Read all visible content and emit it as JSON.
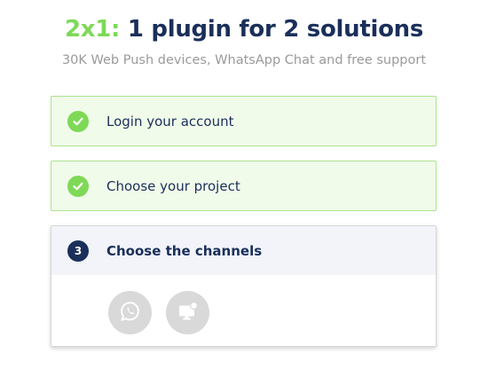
{
  "header": {
    "accent": "2x1:",
    "title": "1 plugin for 2 solutions",
    "subtitle": "30K Web Push devices, WhatsApp Chat and free support"
  },
  "steps": [
    {
      "label": "Login your account",
      "status": "done",
      "icon": "check-icon"
    },
    {
      "label": "Choose your project",
      "status": "done",
      "icon": "check-icon"
    },
    {
      "number": "3",
      "label": "Choose the channels",
      "status": "active"
    }
  ],
  "channels": [
    {
      "icon": "whatsapp-icon"
    },
    {
      "icon": "web-push-icon"
    }
  ],
  "colors": {
    "accent_green": "#7ed957",
    "navy": "#1a2f5a",
    "done_bg": "#f1fbea",
    "done_border": "#a9e38b",
    "subtitle_gray": "#9a9a9a",
    "channel_gray": "#d9d9d9"
  }
}
